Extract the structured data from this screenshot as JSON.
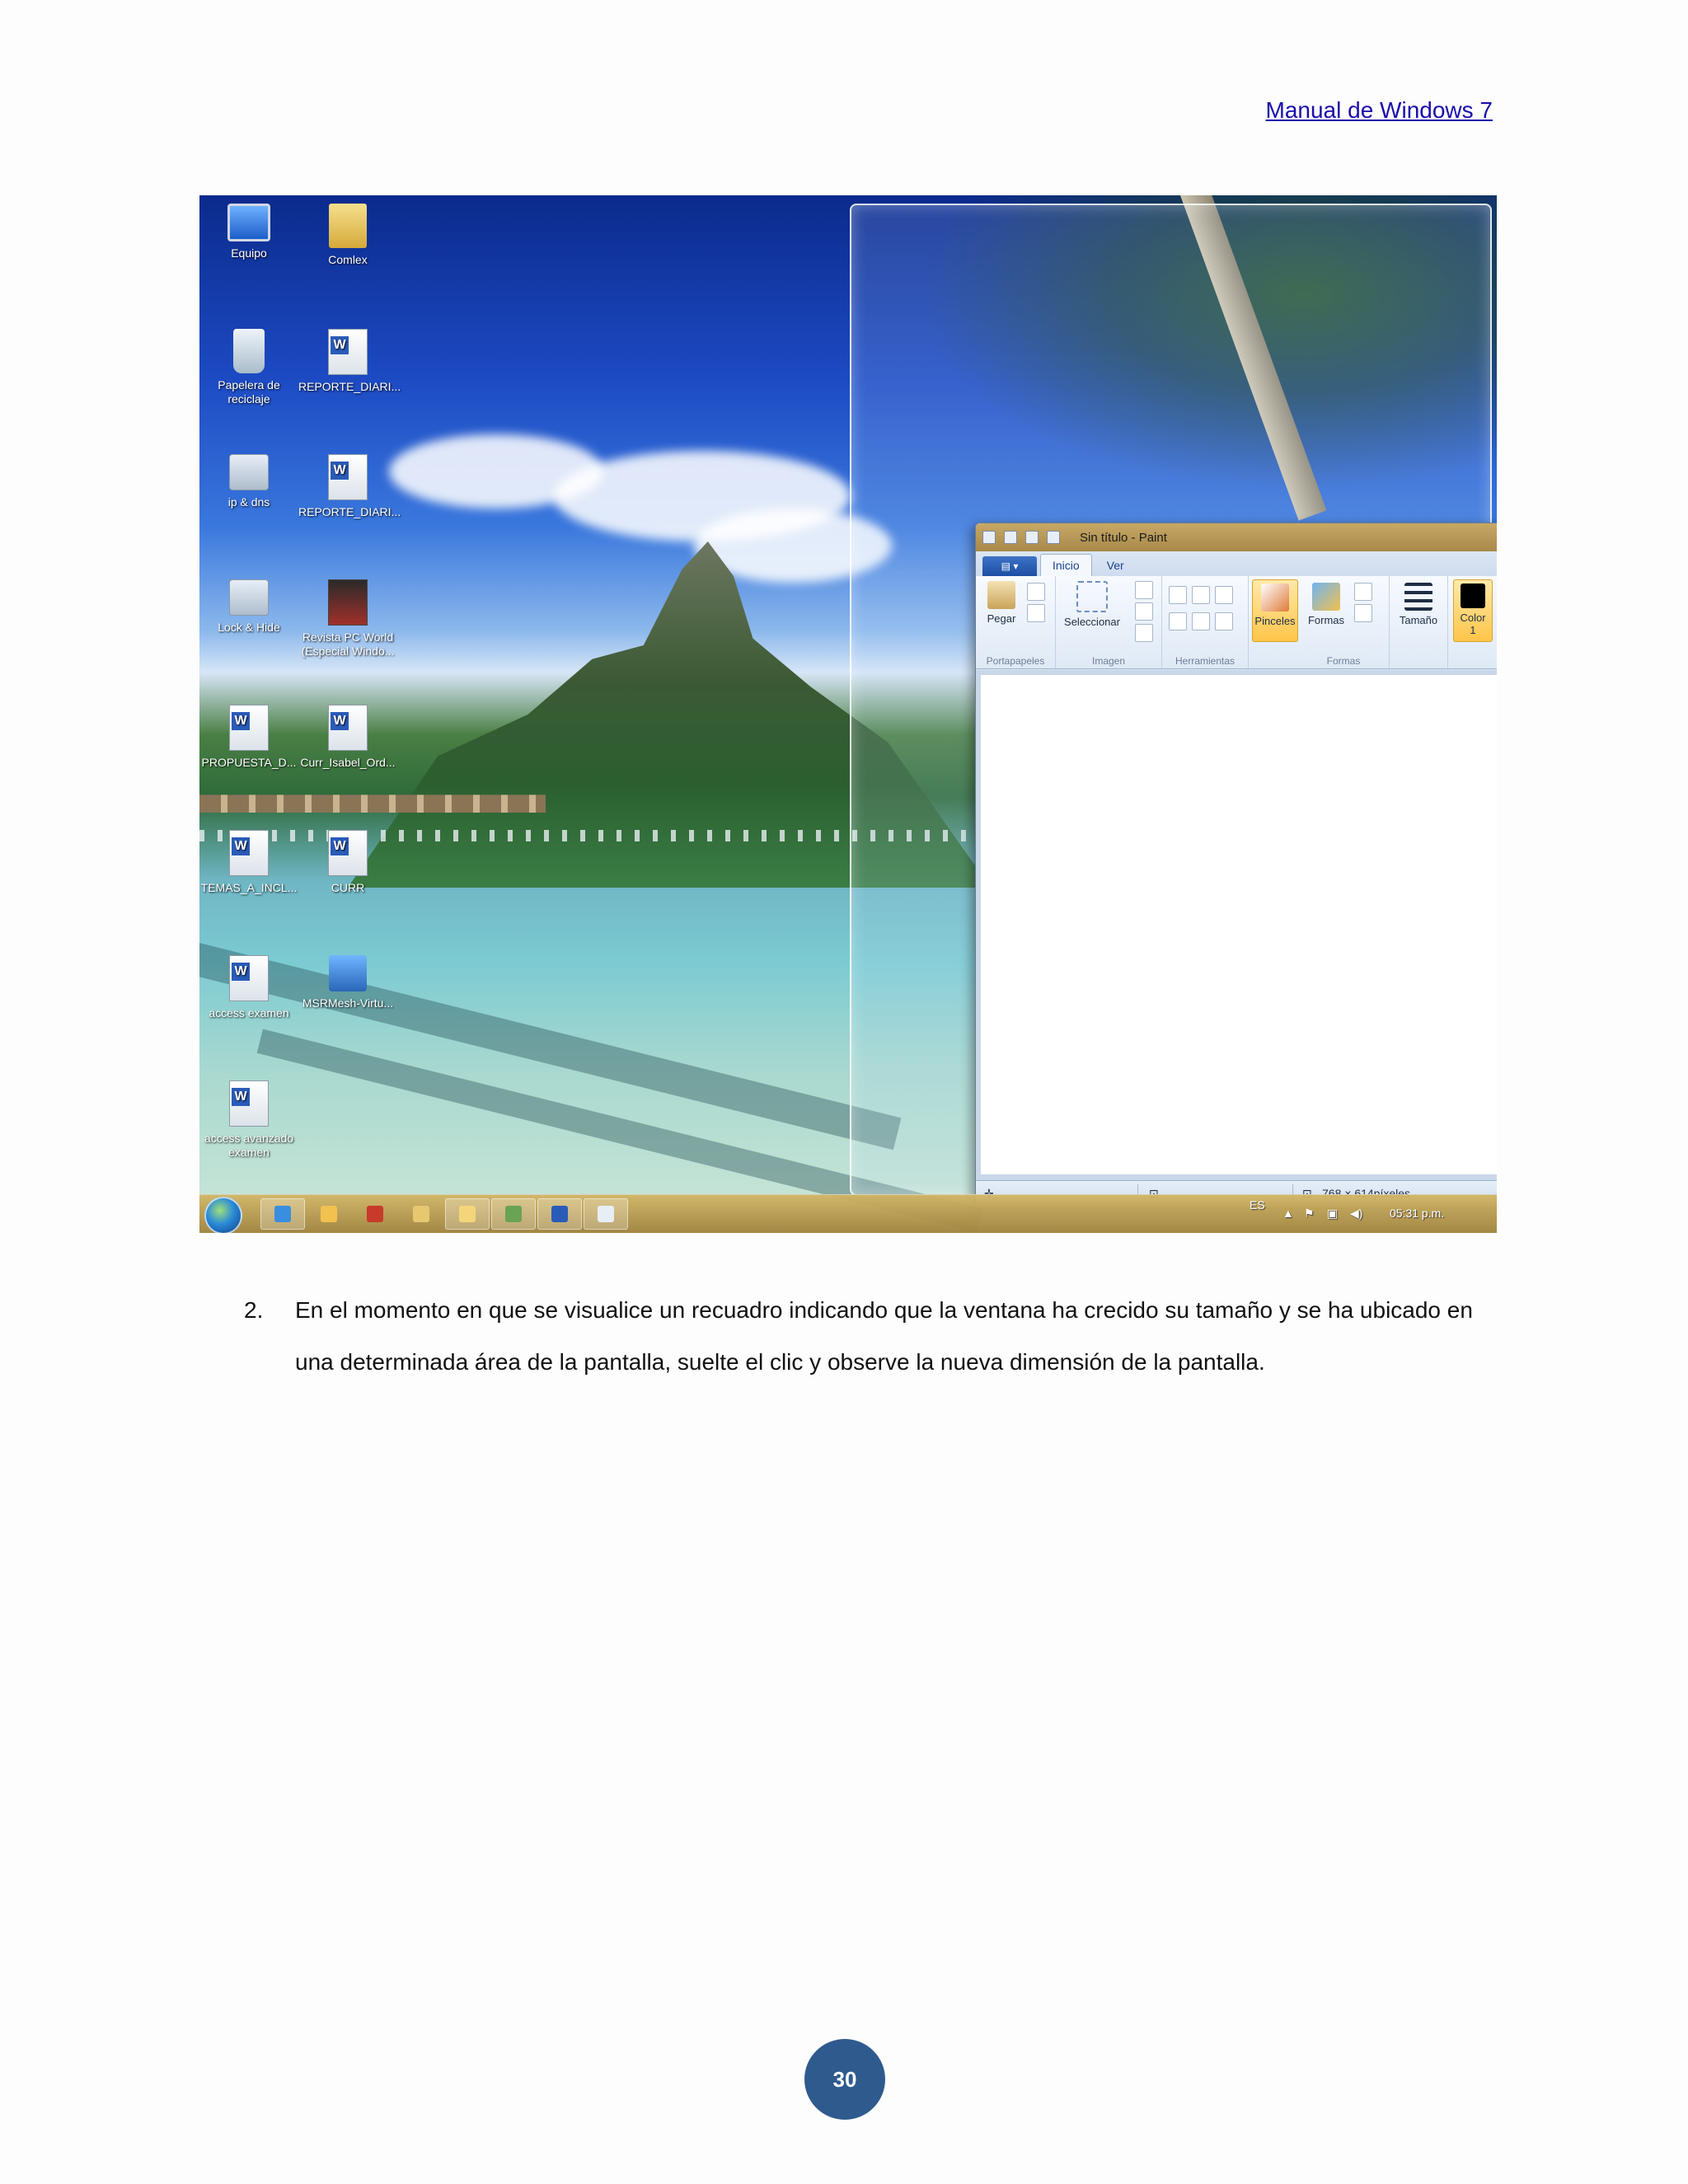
{
  "header": {
    "link_text": "Manual de Windows 7"
  },
  "desktop": {
    "icons": [
      {
        "label": "Equipo",
        "icon": "computer-icon"
      },
      {
        "label": "Comlex",
        "icon": "folder-icon"
      },
      {
        "label": "Papelera de reciclaje",
        "icon": "recycle-bin-icon"
      },
      {
        "label": "REPORTE_DIARI...",
        "icon": "word-document-icon"
      },
      {
        "label": "ip & dns",
        "icon": "settings-icon"
      },
      {
        "label": "REPORTE_DIARI...",
        "icon": "word-document-icon"
      },
      {
        "label": "Lock & Hide",
        "icon": "settings-icon"
      },
      {
        "label": "Revista PC World (Especial Windo...",
        "icon": "pdf-magazine-icon"
      },
      {
        "label": "PROPUESTA_D...",
        "icon": "word-document-icon"
      },
      {
        "label": "Curr_Isabel_Ord...",
        "icon": "word-document-icon"
      },
      {
        "label": "TEMAS_A_INCL...",
        "icon": "word-document-icon"
      },
      {
        "label": "CURR",
        "icon": "word-document-icon"
      },
      {
        "label": "access examen",
        "icon": "word-document-icon"
      },
      {
        "label": "MSRMesh-Virtu...",
        "icon": "installer-icon"
      },
      {
        "label": "access avanzado examen",
        "icon": "word-document-icon"
      }
    ]
  },
  "paint": {
    "title": "Sin título - Paint",
    "tabs": [
      "Inicio",
      "Ver"
    ],
    "buttons": {
      "paste": "Pegar",
      "select": "Seleccionar",
      "brushes": "Pinceles",
      "shapes": "Formas",
      "size": "Tamaño",
      "color": "Color",
      "color_num": "1"
    },
    "groups": {
      "clipboard": "Portapapeles",
      "image": "Imagen",
      "tools": "Herramientas",
      "shapes": "Formas"
    },
    "status": {
      "dimensions": "768 × 614píxeles"
    }
  },
  "taskbar": {
    "language": "ES",
    "clock": "05:31 p.m."
  },
  "body": {
    "step_number": "2.",
    "step_text": "En el momento en que se visualice un recuadro indicando que la ventana ha crecido su tamaño y se ha ubicado en una determinada área de la pantalla, suelte el clic y observe la nueva dimensión de la pantalla."
  },
  "footer": {
    "page_number": "30"
  }
}
